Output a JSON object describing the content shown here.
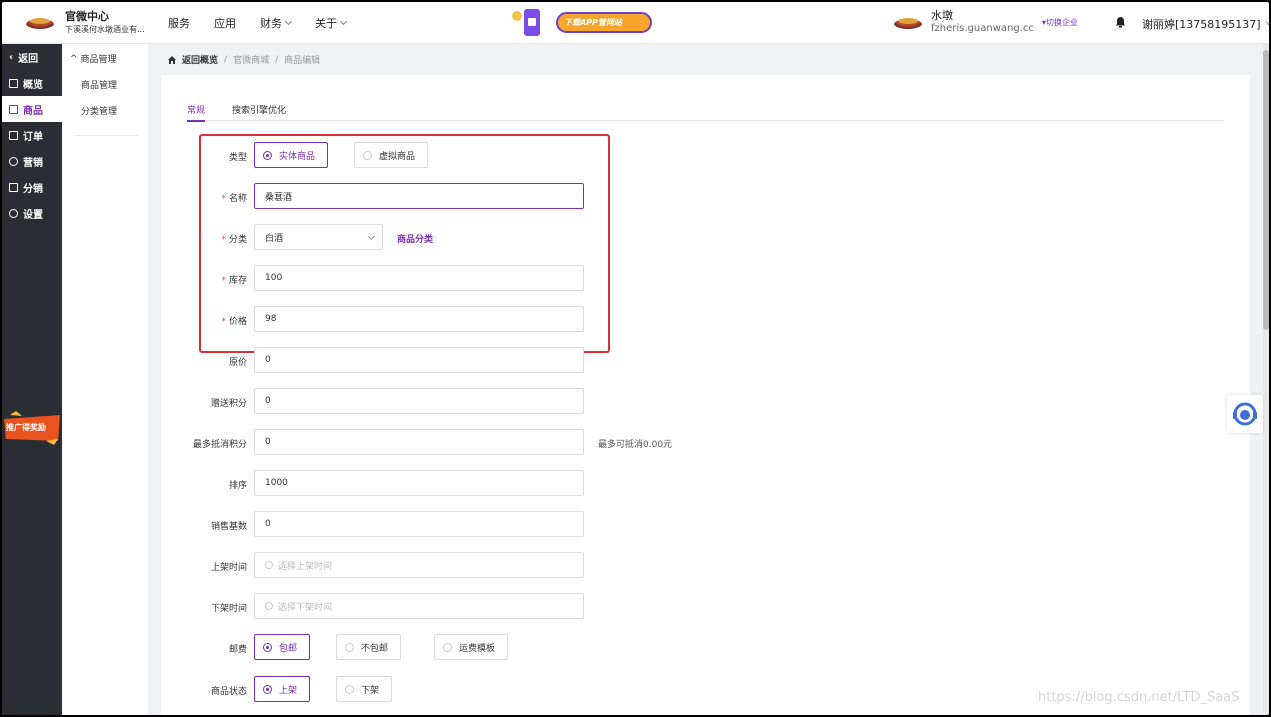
{
  "header": {
    "brand_title": "官微中心",
    "brand_subtitle": "下溪溪何水墩酒业有...",
    "nav": [
      {
        "label": "服务",
        "dropdown": false
      },
      {
        "label": "应用",
        "dropdown": false
      },
      {
        "label": "财务",
        "dropdown": true
      },
      {
        "label": "关于",
        "dropdown": true
      }
    ],
    "banner_text": "下载APP管网站",
    "company_name": "水墩",
    "company_domain": "fzheris.guanwang.cc",
    "switch_label": "▾切换企业",
    "user_name": "谢丽婷[13758195137]"
  },
  "sidebar": {
    "items": [
      {
        "label": "返回",
        "icon": "chevron-left-icon"
      },
      {
        "label": "概览",
        "icon": "overview-icon"
      },
      {
        "label": "商品",
        "icon": "product-icon",
        "active": true
      },
      {
        "label": "订单",
        "icon": "order-icon"
      },
      {
        "label": "营销",
        "icon": "marketing-icon"
      },
      {
        "label": "分销",
        "icon": "distribution-icon"
      },
      {
        "label": "设置",
        "icon": "settings-icon"
      }
    ],
    "promo_text": "推广得奖励"
  },
  "subsidebar": {
    "group_label": "商品管理",
    "items": [
      "商品管理",
      "分类管理"
    ]
  },
  "breadcrumb": [
    "返回概览",
    "官微商城",
    "商品编辑"
  ],
  "tabs": [
    "常规",
    "搜索引擎优化"
  ],
  "form": {
    "type_label": "类型",
    "type_options": [
      "实体商品",
      "虚拟商品"
    ],
    "name_label": "名称",
    "name_value": "桑葚酒",
    "category_label": "分类",
    "category_value": "白酒",
    "category_link": "商品分类",
    "stock_label": "库存",
    "stock_value": "100",
    "price_label": "价格",
    "price_value": "98",
    "original_price_label": "原价",
    "original_price_value": "0",
    "gift_points_label": "赠送积分",
    "gift_points_value": "0",
    "max_points_label": "最多抵消积分",
    "max_points_value": "0",
    "max_points_hint": "最多可抵消0.00元",
    "sort_label": "排序",
    "sort_value": "1000",
    "sales_base_label": "销售基数",
    "sales_base_value": "0",
    "on_shelf_label": "上架时间",
    "on_shelf_placeholder": "选择上架时间",
    "off_shelf_label": "下架时间",
    "off_shelf_placeholder": "选择下架时间",
    "shipping_label": "邮费",
    "shipping_options": [
      "包邮",
      "不包邮",
      "运费模板"
    ],
    "status_label": "商品状态",
    "status_options": [
      "上架",
      "下架"
    ]
  },
  "watermark": "https://blog.csdn.net/LTD_SaaS",
  "colors": {
    "accent": "#7a2fb5",
    "highlight": "#d92e3c",
    "sidebar": "#2a2d31"
  }
}
